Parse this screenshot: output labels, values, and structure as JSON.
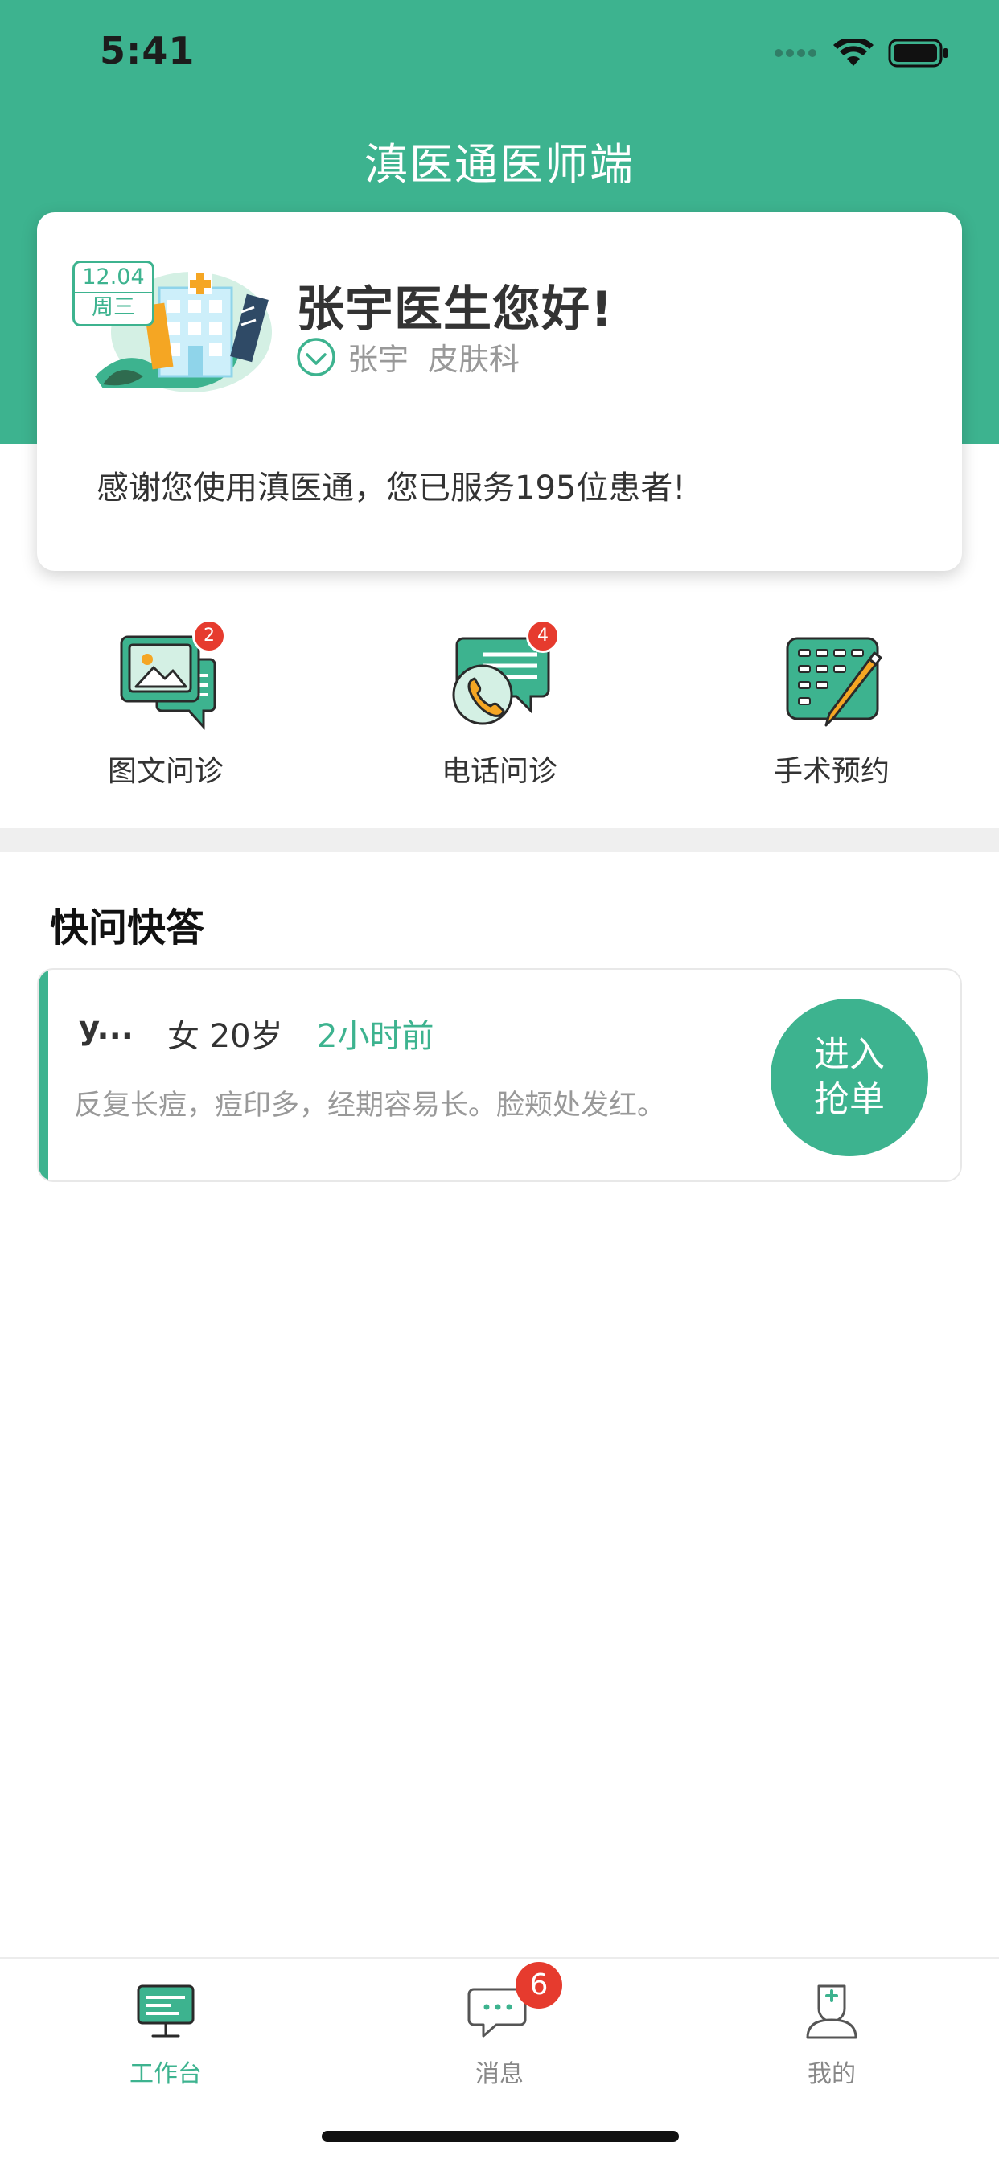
{
  "status_bar": {
    "time": "5:41"
  },
  "app": {
    "title": "滇医通医师端"
  },
  "profile": {
    "date": "12.04",
    "weekday": "周三",
    "greeting": "张宇医生您好!",
    "doctor_name": "张宇",
    "department": "皮肤科",
    "served_text": "感谢您使用滇医通，您已服务195位患者!"
  },
  "quick_actions": [
    {
      "label": "图文问诊",
      "badge": "2",
      "icon": "image-text-consult-icon"
    },
    {
      "label": "电话问诊",
      "badge": "4",
      "icon": "phone-consult-icon"
    },
    {
      "label": "手术预约",
      "icon": "surgery-appointment-icon"
    }
  ],
  "quick_qa": {
    "title": "快问快答",
    "orders": [
      {
        "patient": "y...",
        "gender_age": "女 20岁",
        "time_ago": "2小时前",
        "description": "反复长痘，痘印多，经期容易长。脸颊处发红。",
        "button_line1": "进入",
        "button_line2": "抢单"
      }
    ]
  },
  "tabbar": {
    "items": [
      {
        "label": "工作台",
        "active": true,
        "icon": "workbench-icon"
      },
      {
        "label": "消息",
        "badge": "6",
        "icon": "message-icon"
      },
      {
        "label": "我的",
        "icon": "doctor-profile-icon"
      }
    ]
  },
  "colors": {
    "primary": "#3db38f",
    "badge": "#e63b2e",
    "accent": "#f5a623"
  }
}
